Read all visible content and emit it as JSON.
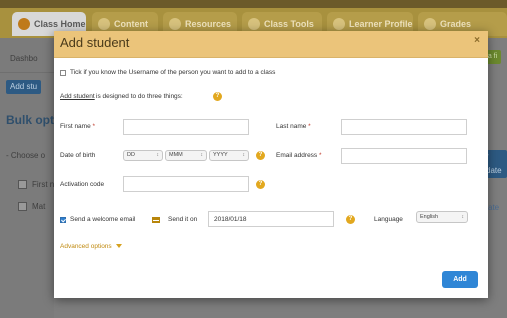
{
  "background": {
    "tabs": [
      {
        "label": "Class Home",
        "active": true
      },
      {
        "label": "Content",
        "active": false
      },
      {
        "label": "Resources",
        "active": false
      },
      {
        "label": "Class Tools",
        "active": false
      },
      {
        "label": "Learner Profile",
        "active": false
      },
      {
        "label": "Grades",
        "active": false
      }
    ],
    "left_labels": {
      "dashboard": "Dashbo",
      "add_student": "Add stu",
      "bulk_options": "Bulk opti",
      "choose": "- Choose o",
      "first_row": "First n",
      "second_row": "Mat"
    },
    "right_buttons": {
      "green": "e a fi",
      "blue": "r date"
    },
    "right_text": "ate"
  },
  "modal": {
    "title": "Add student",
    "close": "×",
    "username_checkbox_label": "Tick if you know the Username of the person you want to add to a class",
    "intro_link": "Add student",
    "intro_rest": "is designed to do three things:",
    "first_name_label": "First name",
    "last_name_label": "Last name",
    "required_mark": "*",
    "dob_label": "Date of birth",
    "dob_day": "DD",
    "dob_month": "MMM",
    "dob_year": "YYYY",
    "email_label": "Email address",
    "activation_label": "Activation code",
    "welcome_email_label": "Send a welcome email",
    "send_it_on_label": "Send it on",
    "send_date": "2018/01/18",
    "language_label": "Language",
    "language_value": "English",
    "advanced_options": "Advanced options",
    "add_button": "Add"
  },
  "colors": {
    "modal_header": "#ebc47a",
    "accent_blue": "#2f86d6",
    "help_orange": "#e2a81f"
  }
}
